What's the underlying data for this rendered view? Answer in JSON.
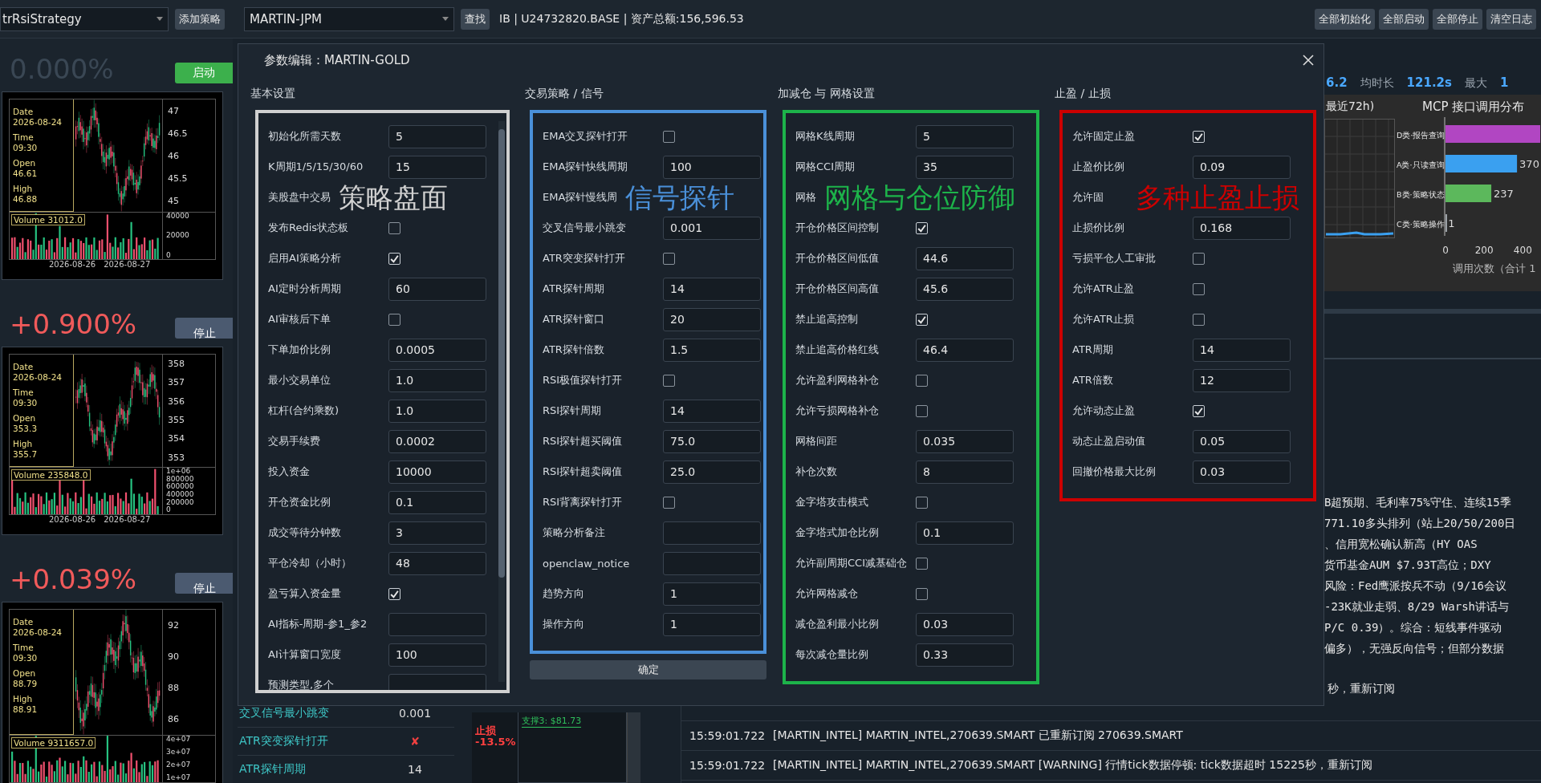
{
  "top_bar": {
    "strategy_select": "trRsiStrategy",
    "add_button": "添加策略",
    "symbol_select": "MARTIN-JPM",
    "find_button": "查找",
    "account": "IB | U24732820.BASE | 资产总额:156,596.53",
    "actions": [
      "全部初始化",
      "全部启动",
      "全部停止",
      "清空日志"
    ]
  },
  "strategies": [
    {
      "change": "0.000%",
      "kind": "flat",
      "button": {
        "label": "启动",
        "kind": "start"
      },
      "tooltip": [
        {
          "label": "Date",
          "value": "2026-08-24"
        },
        {
          "label": "Time",
          "value": "09:30"
        },
        {
          "label": "Open",
          "value": "46.61"
        },
        {
          "label": "High",
          "value": "46.88"
        }
      ],
      "price_ticks": [
        "47",
        "46.5",
        "46",
        "45.5",
        "45"
      ],
      "volume": "Volume 31012.0",
      "volume_ticks": [
        "40000",
        "20000",
        "0"
      ],
      "x_labels": [
        "2026-08-26",
        "2026-08-27"
      ]
    },
    {
      "change": "+0.900%",
      "kind": "up",
      "button": {
        "label": "停止",
        "kind": "stop"
      },
      "tooltip": [
        {
          "label": "Date",
          "value": "2026-08-24"
        },
        {
          "label": "Time",
          "value": "09:30"
        },
        {
          "label": "Open",
          "value": "353.3"
        },
        {
          "label": "High",
          "value": "355.7"
        }
      ],
      "price_ticks": [
        "358",
        "357",
        "356",
        "355",
        "354",
        "353"
      ],
      "volume": "Volume 235848.0",
      "volume_ticks": [
        "1e+06",
        "800000",
        "600000",
        "400000",
        "200000",
        "0"
      ],
      "x_labels": [
        "2026-08-26",
        "2026-08-27"
      ]
    },
    {
      "change": "+0.039%",
      "kind": "up",
      "button": {
        "label": "停止",
        "kind": "stop"
      },
      "tooltip": [
        {
          "label": "Date",
          "value": "2026-08-24"
        },
        {
          "label": "Time",
          "value": "09:30"
        },
        {
          "label": "Open",
          "value": "88.79"
        },
        {
          "label": "High",
          "value": "88.91"
        }
      ],
      "price_ticks": [
        "92",
        "90",
        "88",
        "86"
      ],
      "volume": "Volume 9311657.0",
      "volume_ticks": [
        "4e+07",
        "3e+07",
        "2e+07",
        "1e+07"
      ]
    }
  ],
  "dialog": {
    "title": "参数编辑：MARTIN-GOLD",
    "confirm": "确定",
    "panels": [
      {
        "heading": "基本设置",
        "color": "#d0d0d0",
        "annotation": "策略盘面",
        "scrollbar": true,
        "rows": [
          {
            "label": "初始化所需天数",
            "kind": "text",
            "value": "5"
          },
          {
            "label": "K周期1/5/15/30/60",
            "kind": "text",
            "value": "15"
          },
          {
            "label": "美股盘中交易",
            "kind": "covered"
          },
          {
            "label": "发布Redis状态板",
            "kind": "check",
            "checked": false
          },
          {
            "label": "启用AI策略分析",
            "kind": "check",
            "checked": true
          },
          {
            "label": "AI定时分析周期",
            "kind": "text",
            "value": "60"
          },
          {
            "label": "AI审核后下单",
            "kind": "check",
            "checked": false
          },
          {
            "label": "下单加价比例",
            "kind": "text",
            "value": "0.0005"
          },
          {
            "label": "最小交易单位",
            "kind": "text",
            "value": "1.0"
          },
          {
            "label": "杠杆(合约乘数)",
            "kind": "text",
            "value": "1.0"
          },
          {
            "label": "交易手续费",
            "kind": "text",
            "value": "0.0002"
          },
          {
            "label": "投入资金",
            "kind": "text",
            "value": "10000"
          },
          {
            "label": "开仓资金比例",
            "kind": "text",
            "value": "0.1"
          },
          {
            "label": "成交等待分钟数",
            "kind": "text",
            "value": "3"
          },
          {
            "label": "平仓冷却（小时）",
            "kind": "text",
            "value": "48"
          },
          {
            "label": "盈亏算入资金量",
            "kind": "check",
            "checked": true
          },
          {
            "label": "AI指标-周期-参1_参2",
            "kind": "text"
          },
          {
            "label": "AI计算窗口宽度",
            "kind": "text",
            "value": "100"
          },
          {
            "label": "预测类型,多个",
            "kind": "text"
          }
        ]
      },
      {
        "heading": "交易策略 / 信号",
        "color": "#4a90d9",
        "annotation": "信号探针",
        "rows": [
          {
            "label": "EMA交叉探针打开",
            "kind": "check",
            "checked": false
          },
          {
            "label": "EMA探针快线周期",
            "kind": "text",
            "value": "100"
          },
          {
            "label": "EMA探针慢线周",
            "kind": "covered"
          },
          {
            "label": "交叉信号最小跳变",
            "kind": "text",
            "value": "0.001"
          },
          {
            "label": "ATR突变探针打开",
            "kind": "check",
            "checked": false
          },
          {
            "label": "ATR探针周期",
            "kind": "text",
            "value": "14"
          },
          {
            "label": "ATR探针窗口",
            "kind": "text",
            "value": "20"
          },
          {
            "label": "ATR探针倍数",
            "kind": "text",
            "value": "1.5"
          },
          {
            "label": "RSI极值探针打开",
            "kind": "check",
            "checked": false
          },
          {
            "label": "RSI探针周期",
            "kind": "text",
            "value": "14"
          },
          {
            "label": "RSI探针超买阈值",
            "kind": "text",
            "value": "75.0"
          },
          {
            "label": "RSI探针超卖阈值",
            "kind": "text",
            "value": "25.0"
          },
          {
            "label": "RSI背离探针打开",
            "kind": "check",
            "checked": false
          },
          {
            "label": "策略分析备注",
            "kind": "text"
          },
          {
            "label": "openclaw_notice",
            "kind": "text"
          },
          {
            "label": "趋势方向",
            "kind": "text",
            "value": "1"
          },
          {
            "label": "操作方向",
            "kind": "text",
            "value": "1"
          }
        ]
      },
      {
        "heading": "加减仓 与 网格设置",
        "color": "#1db34a",
        "annotation": "网格与仓位防御",
        "rows": [
          {
            "label": "网格K线周期",
            "kind": "text",
            "value": "5"
          },
          {
            "label": "网格CCI周期",
            "kind": "text",
            "value": "35"
          },
          {
            "label": "网格",
            "kind": "covered"
          },
          {
            "label": "开仓价格区间控制",
            "kind": "check",
            "checked": true
          },
          {
            "label": "开仓价格区间低值",
            "kind": "text",
            "value": "44.6"
          },
          {
            "label": "开仓价格区间高值",
            "kind": "text",
            "value": "45.6"
          },
          {
            "label": "禁止追高控制",
            "kind": "check",
            "checked": true
          },
          {
            "label": "禁止追高价格红线",
            "kind": "text",
            "value": "46.4"
          },
          {
            "label": "允许盈利网格补仓",
            "kind": "check",
            "checked": false
          },
          {
            "label": "允许亏损网格补仓",
            "kind": "check",
            "checked": false
          },
          {
            "label": "网格间距",
            "kind": "text",
            "value": "0.035"
          },
          {
            "label": "补仓次数",
            "kind": "text",
            "value": "8"
          },
          {
            "label": "金字塔攻击模式",
            "kind": "check",
            "checked": false
          },
          {
            "label": "金字塔式加仓比例",
            "kind": "text",
            "value": "0.1"
          },
          {
            "label": "允许副周期CCI减基础仓",
            "kind": "check",
            "checked": false
          },
          {
            "label": "允许网格减仓",
            "kind": "check",
            "checked": false
          },
          {
            "label": "减仓盈利最小比例",
            "kind": "text",
            "value": "0.03"
          },
          {
            "label": "每次减仓量比例",
            "kind": "text",
            "value": "0.33"
          }
        ]
      },
      {
        "heading": "止盈 / 止损",
        "color": "#cc0000",
        "annotation": "多种止盈止损",
        "rows": [
          {
            "label": "允许固定止盈",
            "kind": "check",
            "checked": true
          },
          {
            "label": "止盈价比例",
            "kind": "text",
            "value": "0.09"
          },
          {
            "label": "允许固",
            "kind": "covered"
          },
          {
            "label": "止损价比例",
            "kind": "text",
            "value": "0.168"
          },
          {
            "label": "亏损平仓人工审批",
            "kind": "check",
            "checked": false
          },
          {
            "label": "允许ATR止盈",
            "kind": "check",
            "checked": false
          },
          {
            "label": "允许ATR止损",
            "kind": "check",
            "checked": false
          },
          {
            "label": "ATR周期",
            "kind": "text",
            "value": "14"
          },
          {
            "label": "ATR倍数",
            "kind": "text",
            "value": "12"
          },
          {
            "label": "允许动态止盈",
            "kind": "check",
            "checked": true
          },
          {
            "label": "动态止盈启动值",
            "kind": "text",
            "value": "0.05"
          },
          {
            "label": "回撤价格最大比例",
            "kind": "text",
            "value": "0.03"
          }
        ]
      }
    ]
  },
  "right_panel": {
    "stats": [
      {
        "kind": "value",
        "text": "6.2"
      },
      {
        "kind": "label",
        "text": "均时长"
      },
      {
        "kind": "value",
        "text": "121.2s"
      },
      {
        "kind": "label",
        "text": "最大"
      },
      {
        "kind": "value",
        "text": "1"
      }
    ],
    "trend_title": "最近72h)",
    "mcp_chart": {
      "chart_data": {
        "type": "bar",
        "orientation": "horizontal",
        "title": "MCP 接口调用分布",
        "xlabel": "调用次数（合计 1",
        "categories": [
          "D类·报告查询",
          "A类·只读查询",
          "B类·策略状态",
          "C类·策略操作"
        ],
        "series": [
          {
            "color": "#b146c2",
            "values": [
              490,
              null,
              null,
              null
            ]
          },
          {
            "color": "#3aa0f0",
            "values": [
              null,
              370,
              null,
              null
            ]
          },
          {
            "color": "#5cb85c",
            "values": [
              null,
              null,
              237,
              null
            ]
          },
          {
            "color": "#9aa0a6",
            "values": [
              null,
              null,
              null,
              1
            ]
          }
        ],
        "value_labels": [
          null,
          "370",
          "237",
          "1"
        ],
        "xticks": [
          0,
          200,
          400
        ],
        "xlim": [
          0,
          490
        ]
      }
    },
    "notes": [
      "B超预期、毛利率75%守住、连续15季",
      "771.10多头排列（站上20/50/200日",
      "、信用宽松确认新高（HY OAS",
      "货币基金AUM $7.93T高位；DXY",
      "风险：Fed鹰派按兵不动（9/16会议",
      "-23K就业走弱、8/29 Warsh讲话与",
      " P/C 0.39）。综合：短线事件驱动",
      "偏多），无强反向信号；但部分数据"
    ],
    "log_tail": "秒，重新订阅"
  },
  "param_table": [
    {
      "label": "交叉信号最小跳变",
      "kind": "text",
      "value": "0.001"
    },
    {
      "label": "ATR突变探针打开",
      "kind": "flag",
      "value": "✘"
    },
    {
      "label": "ATR探针周期",
      "kind": "text",
      "value": "14"
    }
  ],
  "price_panel": {
    "support": "支撑3: $81.73",
    "stop_label": "止损",
    "stop_pct": "-13.5%"
  },
  "log": [
    {
      "time": "15:59:01.722",
      "text": "[MARTIN_INTEL]  MARTIN_INTEL,270639.SMART 已重新订阅 270639.SMART"
    },
    {
      "time": "15:59:01.722",
      "text": "[MARTIN_INTEL]  MARTIN_INTEL,270639.SMART [WARNING] 行情tick数据停顿: tick数据超时 15225秒，重新订阅"
    }
  ]
}
